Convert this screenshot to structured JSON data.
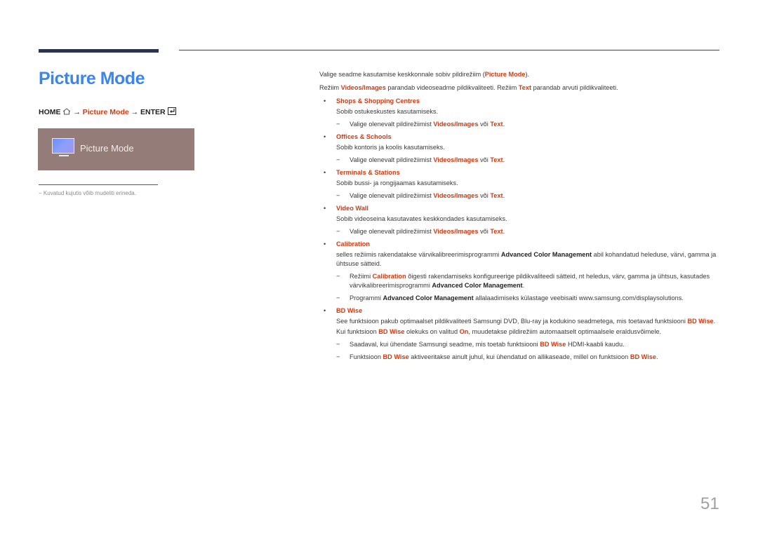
{
  "page": {
    "title": "Picture Mode",
    "page_number": "51"
  },
  "nav_path": {
    "home": "HOME",
    "home_icon": "home-icon",
    "arrow": "→",
    "menu": "Picture Mode",
    "enter": "ENTER",
    "enter_icon": "enter-icon"
  },
  "osd": {
    "icon": "monitor-icon",
    "label": "Picture Mode"
  },
  "footnote": {
    "dash": "−",
    "text": "Kuvatud kujutis võib mudeliti erineda."
  },
  "content": {
    "intro1": {
      "pre": "Valige seadme kasutamise keskkonnale sobiv pildirežiim (",
      "highlight": "Picture Mode",
      "post": ")."
    },
    "intro2": {
      "pre": "Režiim ",
      "hl1": "Videos/Images",
      "mid": " parandab videoseadme pildikvaliteeti. Režiim ",
      "hl2": "Text",
      "post": " parandab arvuti pildikvaliteeti."
    },
    "bullet": "•",
    "dash": "−",
    "items": [
      {
        "title": "Shops & Shopping Centres",
        "desc": "Sobib ostukeskustes kasutamiseks.",
        "note": {
          "pre": "Valige olenevalt pildirežiimist ",
          "hl1": "Videos/Images",
          "mid": " või ",
          "hl2": "Text",
          "post": "."
        }
      },
      {
        "title": "Offices & Schools",
        "desc": "Sobib kontoris ja koolis kasutamiseks.",
        "note": {
          "pre": "Valige olenevalt pildirežiimist ",
          "hl1": "Videos/Images",
          "mid": " või ",
          "hl2": "Text",
          "post": "."
        }
      },
      {
        "title": "Terminals & Stations",
        "desc": "Sobib bussi- ja rongijaamas kasutamiseks.",
        "note": {
          "pre": "Valige olenevalt pildirežiimist ",
          "hl1": "Videos/Images",
          "mid": " või ",
          "hl2": "Text",
          "post": "."
        }
      },
      {
        "title": "Video Wall",
        "desc": "Sobib videoseina kasutavates keskkondades kasutamiseks.",
        "note": {
          "pre": "Valige olenevalt pildirežiimist ",
          "hl1": "Videos/Images",
          "mid": " või ",
          "hl2": "Text",
          "post": "."
        }
      }
    ],
    "calibration": {
      "title": "Calibration",
      "desc_pre": "selles režiimis rakendatakse värvikalibreerimisprogrammi ",
      "desc_bold": "Advanced Color Management",
      "desc_post": " abil kohandatud heleduse, värvi, gamma ja ühtsuse sätteid.",
      "note1_pre": "Režiimi ",
      "note1_hl": "Calibration",
      "note1_mid": " õigesti rakendamiseks konfigureerige pildikvaliteedi sätteid, nt heledus, värv, gamma ja ühtsus, kasutades värvikalibreerimisprogrammi ",
      "note1_bold": "Advanced Color Management",
      "note1_post": ".",
      "note2_pre": "Programmi ",
      "note2_bold": "Advanced Color Management",
      "note2_post": " allalaadimiseks külastage veebisaiti www.samsung.com/displaysolutions."
    },
    "bdwise": {
      "title": "BD Wise",
      "desc1_pre": "See funktsioon pakub optimaalset pildikvaliteeti Samsungi DVD, Blu-ray ja kodukino seadmetega, mis toetavad funktsiooni ",
      "desc1_hl": "BD Wise",
      "desc1_post": ".",
      "desc2_pre": "Kui funktsioon ",
      "desc2_hl1": "BD Wise",
      "desc2_mid": " olekuks on valitud ",
      "desc2_hl2": "On",
      "desc2_post": ", muudetakse pildirežiim automaatselt optimaalsele eraldusvõimele.",
      "note1_pre": "Saadaval, kui ühendate Samsungi seadme, mis toetab funktsiooni ",
      "note1_hl": "BD Wise",
      "note1_post": " HDMI-kaabli kaudu.",
      "note2_pre": "Funktsioon ",
      "note2_hl1": "BD Wise",
      "note2_mid": " aktiveeritakse ainult juhul, kui ühendatud on allikaseade, millel on funktsioon ",
      "note2_hl2": "BD Wise",
      "note2_post": "."
    }
  }
}
